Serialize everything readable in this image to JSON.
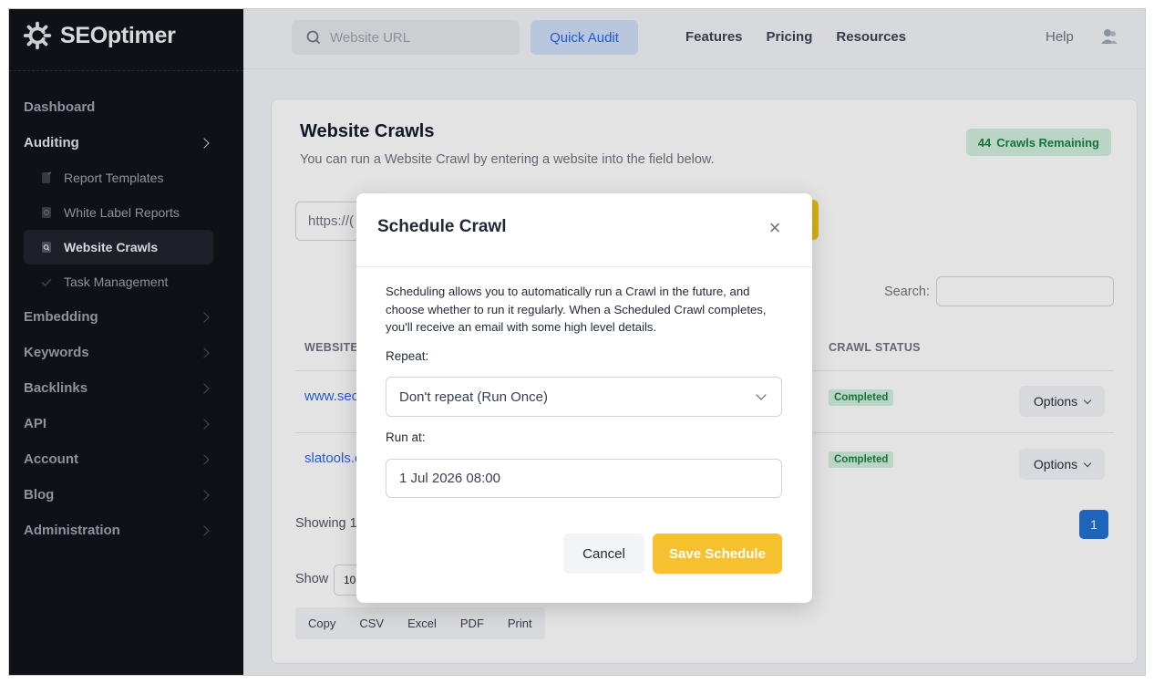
{
  "brand": {
    "name": "SEOptimer"
  },
  "sidebar": {
    "items": [
      {
        "label": "Dashboard"
      },
      {
        "label": "Auditing"
      },
      {
        "label": "Embedding"
      },
      {
        "label": "Keywords"
      },
      {
        "label": "Backlinks"
      },
      {
        "label": "API"
      },
      {
        "label": "Account"
      },
      {
        "label": "Blog"
      },
      {
        "label": "Administration"
      }
    ],
    "auditing_sub": [
      {
        "label": "Report Templates"
      },
      {
        "label": "White Label Reports"
      },
      {
        "label": "Website Crawls"
      },
      {
        "label": "Task Management"
      }
    ]
  },
  "topbar": {
    "url_placeholder": "Website URL",
    "quick_audit": "Quick Audit",
    "nav": [
      "Features",
      "Pricing",
      "Resources"
    ],
    "help": "Help"
  },
  "page": {
    "title": "Website Crawls",
    "subtitle": "You can run a Website Crawl by entering a website into the field below.",
    "remaining_count": "44",
    "remaining_label": "Crawls Remaining",
    "crawl_input_value": "https://(",
    "search_label": "Search:",
    "columns": {
      "website": "WEBSITE",
      "status": "CRAWL STATUS"
    },
    "rows": [
      {
        "website": "www.seo",
        "status": "Completed",
        "options": "Options"
      },
      {
        "website": "slatools.c",
        "status": "Completed",
        "options": "Options"
      }
    ],
    "showing": "Showing 1",
    "pagination_current": "1",
    "show_label": "Show",
    "show_value": "10",
    "export_buttons": [
      "Copy",
      "CSV",
      "Excel",
      "PDF",
      "Print"
    ]
  },
  "modal": {
    "title": "Schedule Crawl",
    "close": "×",
    "description": "Scheduling allows you to automatically run a Crawl in the future, and choose whether to run it regularly. When a Scheduled Crawl completes, you'll receive an email with some high level details.",
    "repeat_label": "Repeat:",
    "repeat_value": "Don't repeat (Run Once)",
    "run_at_label": "Run at:",
    "run_at_value": "1 Jul 2026 08:00",
    "cancel": "Cancel",
    "save": "Save Schedule"
  },
  "colors": {
    "sidebar_bg": "#0f1116",
    "accent_yellow": "#f5c12e",
    "link_blue": "#2563eb",
    "status_green_bg": "#d1f0dc",
    "status_green_text": "#15803d"
  }
}
